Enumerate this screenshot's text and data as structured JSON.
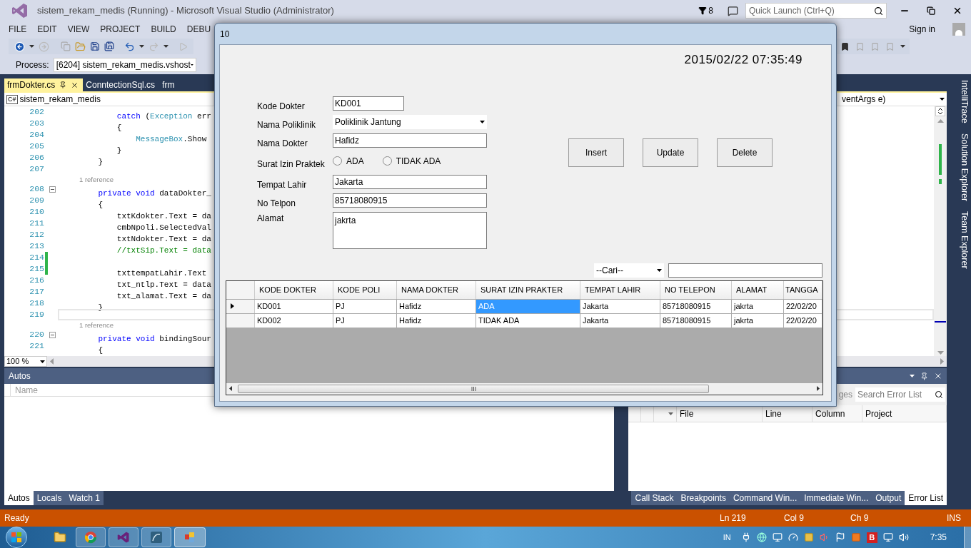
{
  "window": {
    "title": "sistem_rekam_medis (Running) - Microsoft Visual Studio (Administrator)",
    "notifications": "8",
    "quick_launch": {
      "placeholder": "Quick Launch (Ctrl+Q)"
    }
  },
  "menu": [
    "FILE",
    "EDIT",
    "VIEW",
    "PROJECT",
    "BUILD",
    "DEBU"
  ],
  "sign_in": "Sign in",
  "process": {
    "label": "Process:",
    "value": "[6204] sistem_rekam_medis.vshost"
  },
  "doc_tabs": [
    {
      "label": "frmDokter.cs",
      "selected": true
    },
    {
      "label": "ConntectionSql.cs",
      "selected": false
    },
    {
      "label": "frm",
      "selected": false
    }
  ],
  "editor": {
    "language_badge": "C#",
    "project": "sistem_rekam_medis",
    "member": "ventArgs e)",
    "zoom": "100 %",
    "lines": [
      {
        "kind": "code",
        "number": "202",
        "changed": false,
        "current": false,
        "foldable": false,
        "segments": [
          {
            "text": "        catch",
            "kind": "keyword"
          },
          {
            "text": " (",
            "kind": "plain"
          },
          {
            "text": "Exception",
            "kind": "type"
          },
          {
            "text": " err",
            "kind": "plain"
          }
        ]
      },
      {
        "kind": "code",
        "number": "203",
        "changed": false,
        "current": false,
        "foldable": false,
        "segments": [
          {
            "text": "        {",
            "kind": "plain"
          }
        ]
      },
      {
        "kind": "code",
        "number": "204",
        "changed": false,
        "current": false,
        "foldable": false,
        "segments": [
          {
            "text": "            MessageBox",
            "kind": "type"
          },
          {
            "text": ".Show",
            "kind": "plain"
          }
        ]
      },
      {
        "kind": "code",
        "number": "205",
        "changed": false,
        "current": false,
        "foldable": false,
        "segments": [
          {
            "text": "        }",
            "kind": "plain"
          }
        ]
      },
      {
        "kind": "code",
        "number": "206",
        "changed": false,
        "current": false,
        "foldable": false,
        "segments": [
          {
            "text": "    }",
            "kind": "plain"
          }
        ]
      },
      {
        "kind": "code",
        "number": "207",
        "changed": false,
        "current": false,
        "foldable": false
      },
      {
        "kind": "lens",
        "text": "1 reference"
      },
      {
        "kind": "code",
        "number": "208",
        "changed": false,
        "current": false,
        "foldable": true,
        "segments": [
          {
            "text": "    private",
            "kind": "keyword"
          },
          {
            "text": " void",
            "kind": "keyword"
          },
          {
            "text": " dataDokter_",
            "kind": "plain"
          }
        ]
      },
      {
        "kind": "code",
        "number": "209",
        "changed": false,
        "current": false,
        "foldable": false,
        "segments": [
          {
            "text": "    {",
            "kind": "plain"
          }
        ]
      },
      {
        "kind": "code",
        "number": "210",
        "changed": false,
        "current": false,
        "foldable": false,
        "segments": [
          {
            "text": "        txtKdokter.Text = da",
            "kind": "plain"
          }
        ]
      },
      {
        "kind": "code",
        "number": "211",
        "changed": false,
        "current": false,
        "foldable": false,
        "segments": [
          {
            "text": "        cmbNpoli.SelectedVal",
            "kind": "plain"
          }
        ]
      },
      {
        "kind": "code",
        "number": "212",
        "changed": false,
        "current": false,
        "foldable": false,
        "segments": [
          {
            "text": "        txtNdokter.Text = da",
            "kind": "plain"
          }
        ]
      },
      {
        "kind": "code",
        "number": "213",
        "changed": false,
        "current": false,
        "foldable": false,
        "segments": [
          {
            "text": "        //txtSip.Text = data",
            "kind": "comment"
          }
        ]
      },
      {
        "kind": "code",
        "number": "214",
        "changed": true,
        "current": false,
        "foldable": false
      },
      {
        "kind": "code",
        "number": "215",
        "changed": true,
        "current": false,
        "foldable": false,
        "segments": [
          {
            "text": "        txttempatLahir.Text",
            "kind": "plain"
          }
        ]
      },
      {
        "kind": "code",
        "number": "216",
        "changed": false,
        "current": false,
        "foldable": false,
        "segments": [
          {
            "text": "        txt_ntlp.Text = data",
            "kind": "plain"
          }
        ]
      },
      {
        "kind": "code",
        "number": "217",
        "changed": false,
        "current": false,
        "foldable": false,
        "segments": [
          {
            "text": "        txt_alamat.Text = da",
            "kind": "plain"
          }
        ]
      },
      {
        "kind": "code",
        "number": "218",
        "changed": false,
        "current": false,
        "foldable": false,
        "segments": [
          {
            "text": "    }",
            "kind": "plain"
          }
        ]
      },
      {
        "kind": "code",
        "number": "219",
        "changed": false,
        "current": true,
        "foldable": false
      },
      {
        "kind": "lens",
        "text": "1 reference"
      },
      {
        "kind": "code",
        "number": "220",
        "changed": false,
        "current": false,
        "foldable": true,
        "segments": [
          {
            "text": "    private",
            "kind": "keyword"
          },
          {
            "text": " void",
            "kind": "keyword"
          },
          {
            "text": " bindingSour",
            "kind": "plain"
          }
        ]
      },
      {
        "kind": "code",
        "number": "221",
        "changed": false,
        "current": false,
        "foldable": false,
        "segments": [
          {
            "text": "    {",
            "kind": "plain"
          }
        ]
      }
    ]
  },
  "side_tabs": [
    "IntelliTrace",
    "Solution Explorer",
    "Team Explorer"
  ],
  "autos": {
    "title": "Autos",
    "columns": [
      "Name"
    ],
    "tabs": [
      {
        "label": "Autos",
        "selected": true
      },
      {
        "label": "Locals",
        "selected": false
      },
      {
        "label": "Watch 1",
        "selected": false
      }
    ]
  },
  "error_list": {
    "filter_fragment": "ges",
    "search": {
      "placeholder": "Search Error List"
    },
    "columns": [
      "File",
      "Line",
      "Column",
      "Project"
    ],
    "tabs": [
      {
        "label": "Call Stack",
        "selected": false
      },
      {
        "label": "Breakpoints",
        "selected": false
      },
      {
        "label": "Command Win...",
        "selected": false
      },
      {
        "label": "Immediate Win...",
        "selected": false
      },
      {
        "label": "Output",
        "selected": false
      },
      {
        "label": "Error List",
        "selected": true
      }
    ]
  },
  "status_bar": {
    "message": "Ready",
    "line": "Ln 219",
    "col": "Col 9",
    "ch": "Ch 9",
    "mode": "INS"
  },
  "dialog": {
    "title": "10",
    "datetime": "2015/02/22 07:35:49",
    "fields": [
      {
        "kind": "text",
        "label": "Kode Dokter",
        "value": "KD001"
      },
      {
        "kind": "combo",
        "label": "Nama Poliklinik",
        "value": "Poliklinik Jantung"
      },
      {
        "kind": "text",
        "label": "Nama Dokter",
        "value": "Hafidz"
      },
      {
        "kind": "radio",
        "label": "Surat Izin Praktek",
        "options": [
          {
            "label": "ADA",
            "selected": false
          },
          {
            "label": "TIDAK ADA",
            "selected": false
          }
        ]
      },
      {
        "kind": "text",
        "label": "Tempat Lahir",
        "value": "Jakarta"
      },
      {
        "kind": "text",
        "label": "No Telpon",
        "value": "85718080915"
      },
      {
        "kind": "textarea",
        "label": "Alamat",
        "value": "jakrta"
      }
    ],
    "buttons": [
      "Insert",
      "Update",
      "Delete"
    ],
    "search": {
      "filter": "--Cari--"
    },
    "grid": {
      "columns": [
        "KODE DOKTER",
        "KODE POLI",
        "NAMA DOKTER",
        "SURAT IZIN PRAKTER",
        "TEMPAT LAHIR",
        "NO TELEPON",
        "ALAMAT",
        "TANGGA"
      ],
      "rows": [
        {
          "current": true,
          "cells": [
            {
              "text": "KD001",
              "selected": false
            },
            {
              "text": "PJ",
              "selected": false
            },
            {
              "text": "Hafidz",
              "selected": false
            },
            {
              "text": "ADA",
              "selected": true
            },
            {
              "text": "Jakarta",
              "selected": false
            },
            {
              "text": "85718080915",
              "selected": false
            },
            {
              "text": "jakrta",
              "selected": false
            },
            {
              "text": "22/02/20",
              "selected": false
            }
          ]
        },
        {
          "current": false,
          "cells": [
            {
              "text": "KD002",
              "selected": false
            },
            {
              "text": "PJ",
              "selected": false
            },
            {
              "text": "Hafidz",
              "selected": false
            },
            {
              "text": "TIDAK ADA",
              "selected": false
            },
            {
              "text": "Jakarta",
              "selected": false
            },
            {
              "text": "85718080915",
              "selected": false
            },
            {
              "text": "jakrta",
              "selected": false
            },
            {
              "text": "22/02/20",
              "selected": false
            }
          ]
        }
      ]
    }
  },
  "taskbar": {
    "language": "IN",
    "tray_badge": "B",
    "clock": "7:35"
  }
}
